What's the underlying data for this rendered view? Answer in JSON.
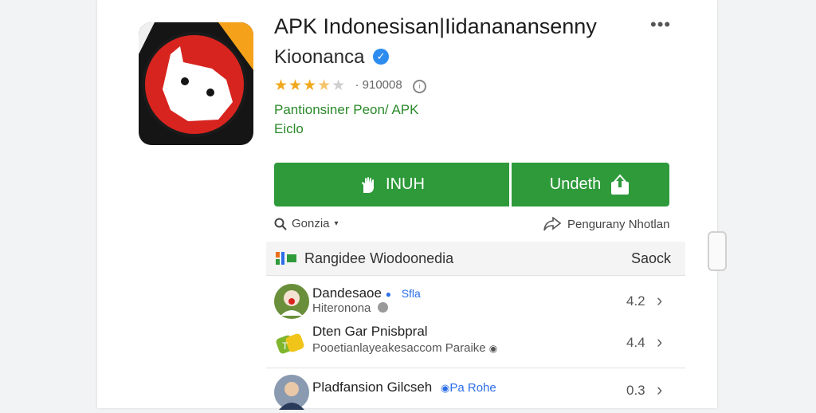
{
  "app": {
    "title": "APK Indonesisan|Iidananansenny",
    "developer": "Kioonanca",
    "rating_stars": 3.5,
    "rating_count": "· 910008",
    "category": "Pantionsiner Peon/ APK",
    "category_extra": "Eiclo"
  },
  "actions": {
    "install_label": "INUH",
    "unlock_label": "Undeth",
    "filter_label": "Gonzia",
    "share_label": "Pengurany Nhotlan"
  },
  "section": {
    "title": "Rangidee Wiodoonedia",
    "action": "Saock"
  },
  "list": [
    {
      "name": "Dandesaoe",
      "tag": "Sfla",
      "sub": "Hiteronona",
      "score": "4.2"
    },
    {
      "name": "Dten Gar Pnisbpral",
      "tag": "",
      "sub": "Pooetianlayeakesaccom Paraike",
      "score": "4.4"
    },
    {
      "name": "Pladfansion Gilcseh",
      "tag": "Pa Rohe",
      "sub": "",
      "score": "0.3"
    }
  ],
  "colors": {
    "accent_green": "#2e9a3a",
    "verified_blue": "#2d8cf0",
    "star_gold": "#f2a81d"
  },
  "icons": [
    "app-logo-icon",
    "verified-icon",
    "star-icon",
    "info-icon",
    "hand-icon",
    "upload-icon",
    "search-icon",
    "share-icon",
    "chevron-right-icon",
    "more-icon"
  ]
}
